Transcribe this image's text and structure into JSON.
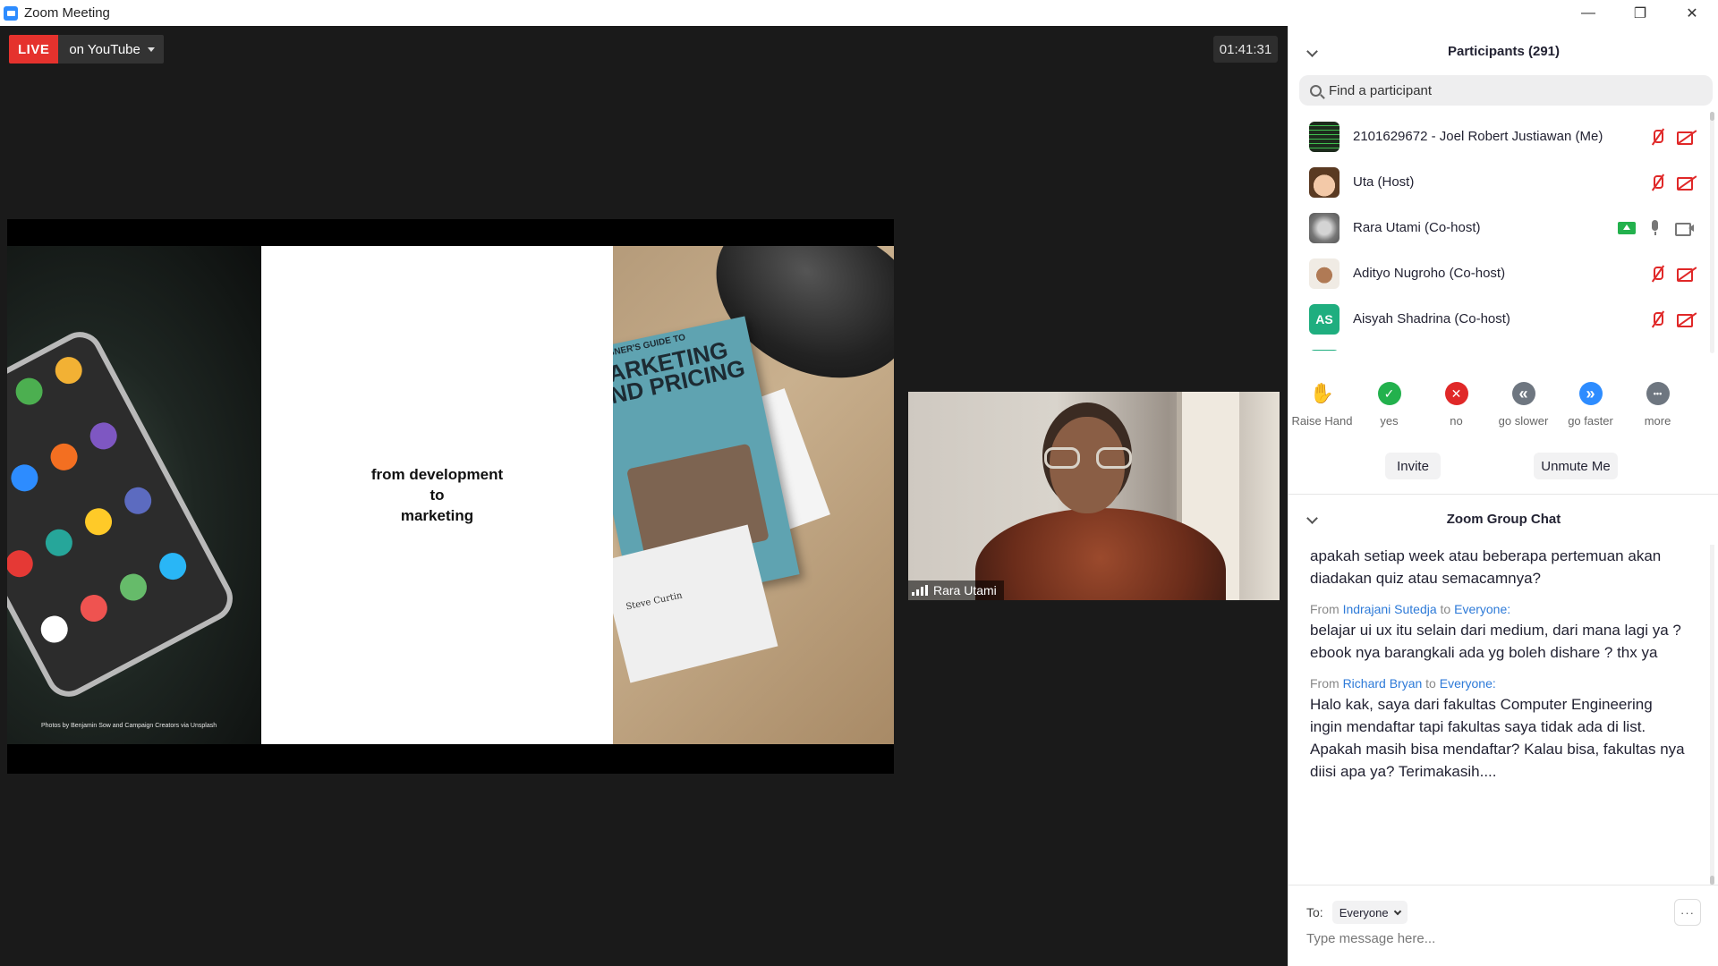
{
  "window": {
    "title": "Zoom Meeting",
    "controls": [
      "—",
      "❐",
      "✕"
    ]
  },
  "live": {
    "badge": "LIVE",
    "destination": "on YouTube"
  },
  "meeting": {
    "timer": "01:41:31"
  },
  "slide": {
    "text_line1": "from development",
    "text_line2": "to",
    "text_line3": "marketing",
    "credit": "Photos by Benjamin Sow and Campaign Creators via Unsplash",
    "book_small": "DESIGNER'S GUIDE TO",
    "book_title_1": "MARKETING",
    "book_title_2": "AND PRICING",
    "author": "Steve Curtin"
  },
  "speaker": {
    "name": "Rara Utami"
  },
  "participants": {
    "title": "Participants (291)",
    "search_placeholder": "Find a participant",
    "list": [
      {
        "name": "2101629672 - Joel Robert Justiawan (Me)",
        "avatar": "",
        "avatar_color": "#1d2b1d"
      },
      {
        "name": "Uta (Host)",
        "avatar": "",
        "avatar_color": "#e7b89a"
      },
      {
        "name": "Rara Utami (Co-host)",
        "avatar": "",
        "avatar_color": "#8f8f8f"
      },
      {
        "name": "Adityo Nugroho (Co-host)",
        "avatar": "",
        "avatar_color": "#6b3d24"
      },
      {
        "name": "Aisyah Shadrina (Co-host)",
        "avatar": "AS",
        "avatar_color": "#1fae7f"
      },
      {
        "name": "",
        "avatar": "",
        "avatar_color": "#1fae7f"
      }
    ]
  },
  "reactions": [
    {
      "label": "Raise Hand",
      "glyph": "✋",
      "color": "#2d8cff"
    },
    {
      "label": "yes",
      "glyph": "✓",
      "color": "#23b14d"
    },
    {
      "label": "no",
      "glyph": "✕",
      "color": "#e02828"
    },
    {
      "label": "go slower",
      "glyph": "«",
      "color": "#6e7680"
    },
    {
      "label": "go faster",
      "glyph": "»",
      "color": "#2d8cff"
    },
    {
      "label": "more",
      "glyph": "•••",
      "color": "#6e7680"
    }
  ],
  "buttons": {
    "invite": "Invite",
    "unmute": "Unmute Me"
  },
  "chat": {
    "title": "Zoom Group Chat",
    "messages": [
      {
        "text": "apakah setiap week atau beberapa pertemuan akan diadakan quiz atau semacamnya?"
      },
      {
        "from_prefix": "From",
        "sender": "Indrajani Sutedja",
        "to_word": "to",
        "recipient": "Everyone:",
        "text": "belajar ui ux itu selain dari medium, dari mana lagi ya ? ebook nya barangkali ada yg boleh dishare ? thx ya"
      },
      {
        "from_prefix": "From",
        "sender": "Richard Bryan",
        "to_word": "to",
        "recipient": "Everyone:",
        "text": "Halo kak, saya dari fakultas Computer Engineering ingin mendaftar tapi fakultas saya tidak ada di list. Apakah masih bisa mendaftar? Kalau bisa, fakultas nya diisi apa ya? Terimakasih...."
      }
    ],
    "to_label": "To:",
    "to_value": "Everyone",
    "more": "···",
    "input_placeholder": "Type message here..."
  }
}
